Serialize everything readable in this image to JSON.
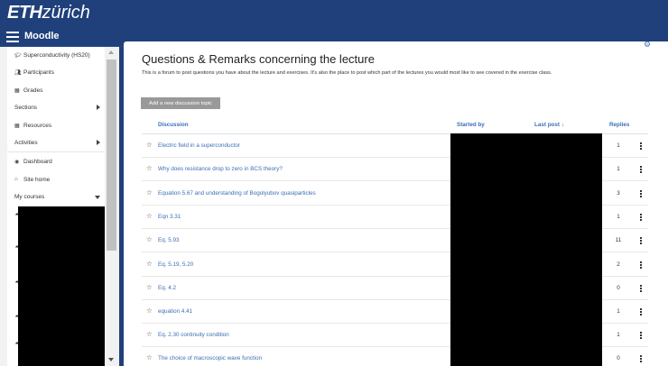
{
  "header": {
    "logo_eth": "ETH",
    "logo_zurich": "zürich",
    "brand": "Moodle"
  },
  "sidebar": {
    "items": [
      {
        "label": "Superconductivity (HS20)",
        "icon": "graduation-cap-icon"
      },
      {
        "label": "Participants",
        "icon": "users-icon"
      },
      {
        "label": "Grades",
        "icon": "table-icon"
      },
      {
        "label": "Sections",
        "icon": ""
      },
      {
        "label": "Resources",
        "icon": "table-icon"
      },
      {
        "label": "Activities",
        "icon": ""
      },
      {
        "label": "Dashboard",
        "icon": "dashboard-icon"
      },
      {
        "label": "Site home",
        "icon": "home-icon"
      },
      {
        "label": "My courses",
        "icon": ""
      }
    ]
  },
  "forum": {
    "title": "Questions & Remarks concerning the lecture",
    "intro": "This is a forum to post questions you have about the lecture and exercises. It's also the place to post which part of the lectures you would most like to see covered in the exercise class.",
    "add_button": "Add a new discussion topic",
    "columns": {
      "discussion": "Discussion",
      "started_by": "Started by",
      "last_post": "Last post",
      "sort_indicator": "↓",
      "replies": "Replies"
    },
    "topics": [
      {
        "title": "Electric field in a superconductor",
        "replies": "1"
      },
      {
        "title": "Why does resistance drop to zero in BCS theory?",
        "replies": "1"
      },
      {
        "title": "Equation 5.67 and understanding of Bogolyubov quasiparticles",
        "replies": "3"
      },
      {
        "title": "Eqn 3.31",
        "replies": "1"
      },
      {
        "title": "Eq. 5.93",
        "replies": "11"
      },
      {
        "title": "Eq. 5.19, 5.20",
        "replies": "2"
      },
      {
        "title": "Eq. 4.2",
        "replies": "0"
      },
      {
        "title": "equation 4.41",
        "replies": "1"
      },
      {
        "title": "Eq. 2.30 continuity condition",
        "replies": "1"
      },
      {
        "title": "The choice of macroscopic wave function",
        "replies": "0"
      }
    ]
  },
  "icons": {
    "star": "☆",
    "gear": "⚙"
  },
  "colors": {
    "header": "#1f407a",
    "link": "#3a6fb5",
    "button": "#999999"
  }
}
